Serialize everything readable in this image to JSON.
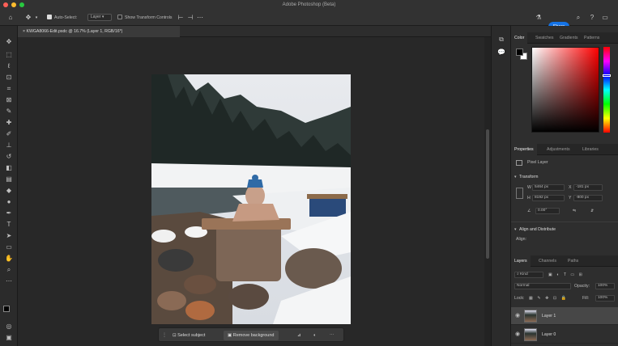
{
  "window": {
    "title": "Adobe Photoshop (Beta)",
    "traffic_colors": [
      "#ff5f57",
      "#febc2e",
      "#28c840"
    ]
  },
  "options_bar": {
    "auto_select_label": "Auto-Select:",
    "auto_select_target": "Layer",
    "show_transform_label": "Show Transform Controls",
    "share_label": "Share",
    "accent": "#1473e6"
  },
  "document_tab": {
    "label": "KWGA8066-Edit.psdc @ 16.7% (Layer 1, RGB/16*)",
    "close_glyph": "×"
  },
  "tools": [
    "move",
    "marquee",
    "lasso",
    "object-select",
    "crop",
    "frame",
    "eyedropper",
    "healing",
    "brush",
    "stamp",
    "history-brush",
    "eraser",
    "gradient",
    "blur",
    "dodge",
    "pen",
    "type",
    "path-select",
    "rectangle",
    "hand",
    "zoom",
    "more"
  ],
  "context_bar": {
    "select_subject": "Select subject",
    "remove_background": "Remove background"
  },
  "color_panel": {
    "tabs": [
      "Color",
      "Swatches",
      "Gradients",
      "Patterns"
    ],
    "active_tab": "Color",
    "foreground": "#000000",
    "background": "#ffffff",
    "hue_color": "#ff0000"
  },
  "properties_panel": {
    "tabs": [
      "Properties",
      "Adjustments",
      "Libraries"
    ],
    "active_tab": "Properties",
    "kind_label": "Pixel Layer",
    "transform_heading": "Transform",
    "w_label": "W",
    "w_value": "5464 px",
    "x_label": "X",
    "x_value": "-181 px",
    "h_label": "H",
    "h_value": "8192 px",
    "y_label": "Y",
    "y_value": "-800 px",
    "angle_value": "0.00°",
    "align_heading": "Align and Distribute",
    "align_sub": "Align:"
  },
  "layers_panel": {
    "tabs": [
      "Layers",
      "Channels",
      "Paths"
    ],
    "active_tab": "Layers",
    "filter_label": "Kind",
    "blend_mode": "Normal",
    "opacity_label": "Opacity:",
    "opacity_value": "100%",
    "lock_label": "Lock:",
    "fill_label": "Fill:",
    "fill_value": "100%",
    "layers": [
      {
        "name": "Layer 1",
        "selected": true
      },
      {
        "name": "Layer 0",
        "selected": false
      }
    ]
  }
}
